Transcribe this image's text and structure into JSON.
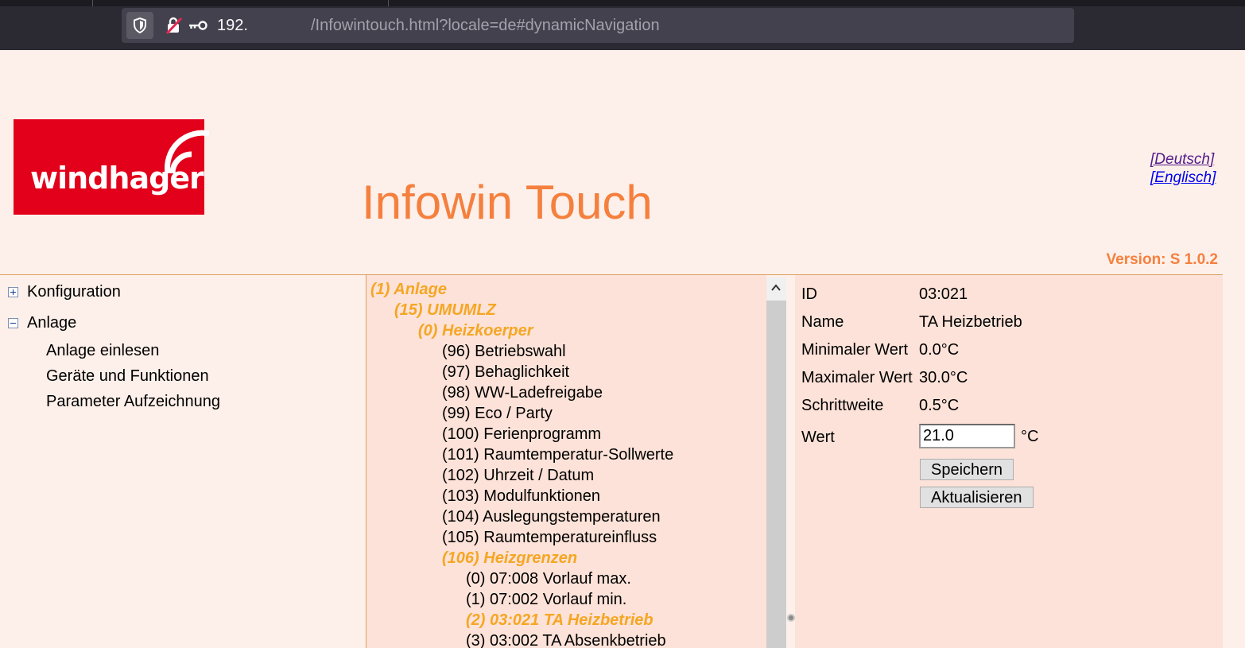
{
  "browser": {
    "url_host": "192.",
    "url_path": "/Infowintouch.html?locale=de#dynamicNavigation"
  },
  "header": {
    "logo_text": "windhager",
    "title": "Infowin Touch",
    "lang_de": "[Deutsch]",
    "lang_en": "[Englisch]",
    "version": "Version: S 1.0.2"
  },
  "nav": {
    "konfiguration": "Konfiguration",
    "anlage": "Anlage",
    "sub": [
      "Anlage einlesen",
      "Geräte und Funktionen",
      "Parameter Aufzeichnung"
    ]
  },
  "tree": [
    {
      "label": "(1) Anlage",
      "level": 0,
      "selected": true
    },
    {
      "label": "(15) UMUMLZ",
      "level": 1,
      "selected": true
    },
    {
      "label": "(0) Heizkoerper",
      "level": 2,
      "selected": true
    },
    {
      "label": "(96) Betriebswahl",
      "level": 3,
      "selected": false
    },
    {
      "label": "(97) Behaglichkeit",
      "level": 3,
      "selected": false
    },
    {
      "label": "(98) WW-Ladefreigabe",
      "level": 3,
      "selected": false
    },
    {
      "label": "(99) Eco / Party",
      "level": 3,
      "selected": false
    },
    {
      "label": "(100) Ferienprogramm",
      "level": 3,
      "selected": false
    },
    {
      "label": "(101) Raumtemperatur-Sollwerte",
      "level": 3,
      "selected": false
    },
    {
      "label": "(102) Uhrzeit / Datum",
      "level": 3,
      "selected": false
    },
    {
      "label": "(103) Modulfunktionen",
      "level": 3,
      "selected": false
    },
    {
      "label": "(104) Auslegungstemperaturen",
      "level": 3,
      "selected": false
    },
    {
      "label": "(105) Raumtemperatureinfluss",
      "level": 3,
      "selected": false
    },
    {
      "label": "(106) Heizgrenzen",
      "level": 3,
      "selected": true
    },
    {
      "label": "(0) 07:008 Vorlauf max.",
      "level": 4,
      "selected": false
    },
    {
      "label": "(1) 07:002 Vorlauf min.",
      "level": 4,
      "selected": false
    },
    {
      "label": "(2) 03:021 TA Heizbetrieb",
      "level": 4,
      "selected": true
    },
    {
      "label": "(3) 03:002 TA Absenkbetrieb",
      "level": 4,
      "selected": false
    }
  ],
  "detail": {
    "id_label": "ID",
    "id_value": "03:021",
    "name_label": "Name",
    "name_value": "TA Heizbetrieb",
    "min_label": "Minimaler Wert",
    "min_value": "0.0°C",
    "max_label": "Maximaler Wert",
    "max_value": "30.0°C",
    "step_label": "Schrittweite",
    "step_value": "0.5°C",
    "wert_label": "Wert",
    "wert_value": "21.0",
    "wert_unit": "°C",
    "save_label": "Speichern",
    "refresh_label": "Aktualisieren"
  },
  "colors": {
    "accent": "#f5803e",
    "selected": "#f5a623",
    "brand_red": "#e2001a"
  },
  "icons": [
    "shield-icon",
    "insecure-lock-icon",
    "key-icon",
    "expand-plus-icon",
    "collapse-minus-icon",
    "scroll-up-icon"
  ]
}
